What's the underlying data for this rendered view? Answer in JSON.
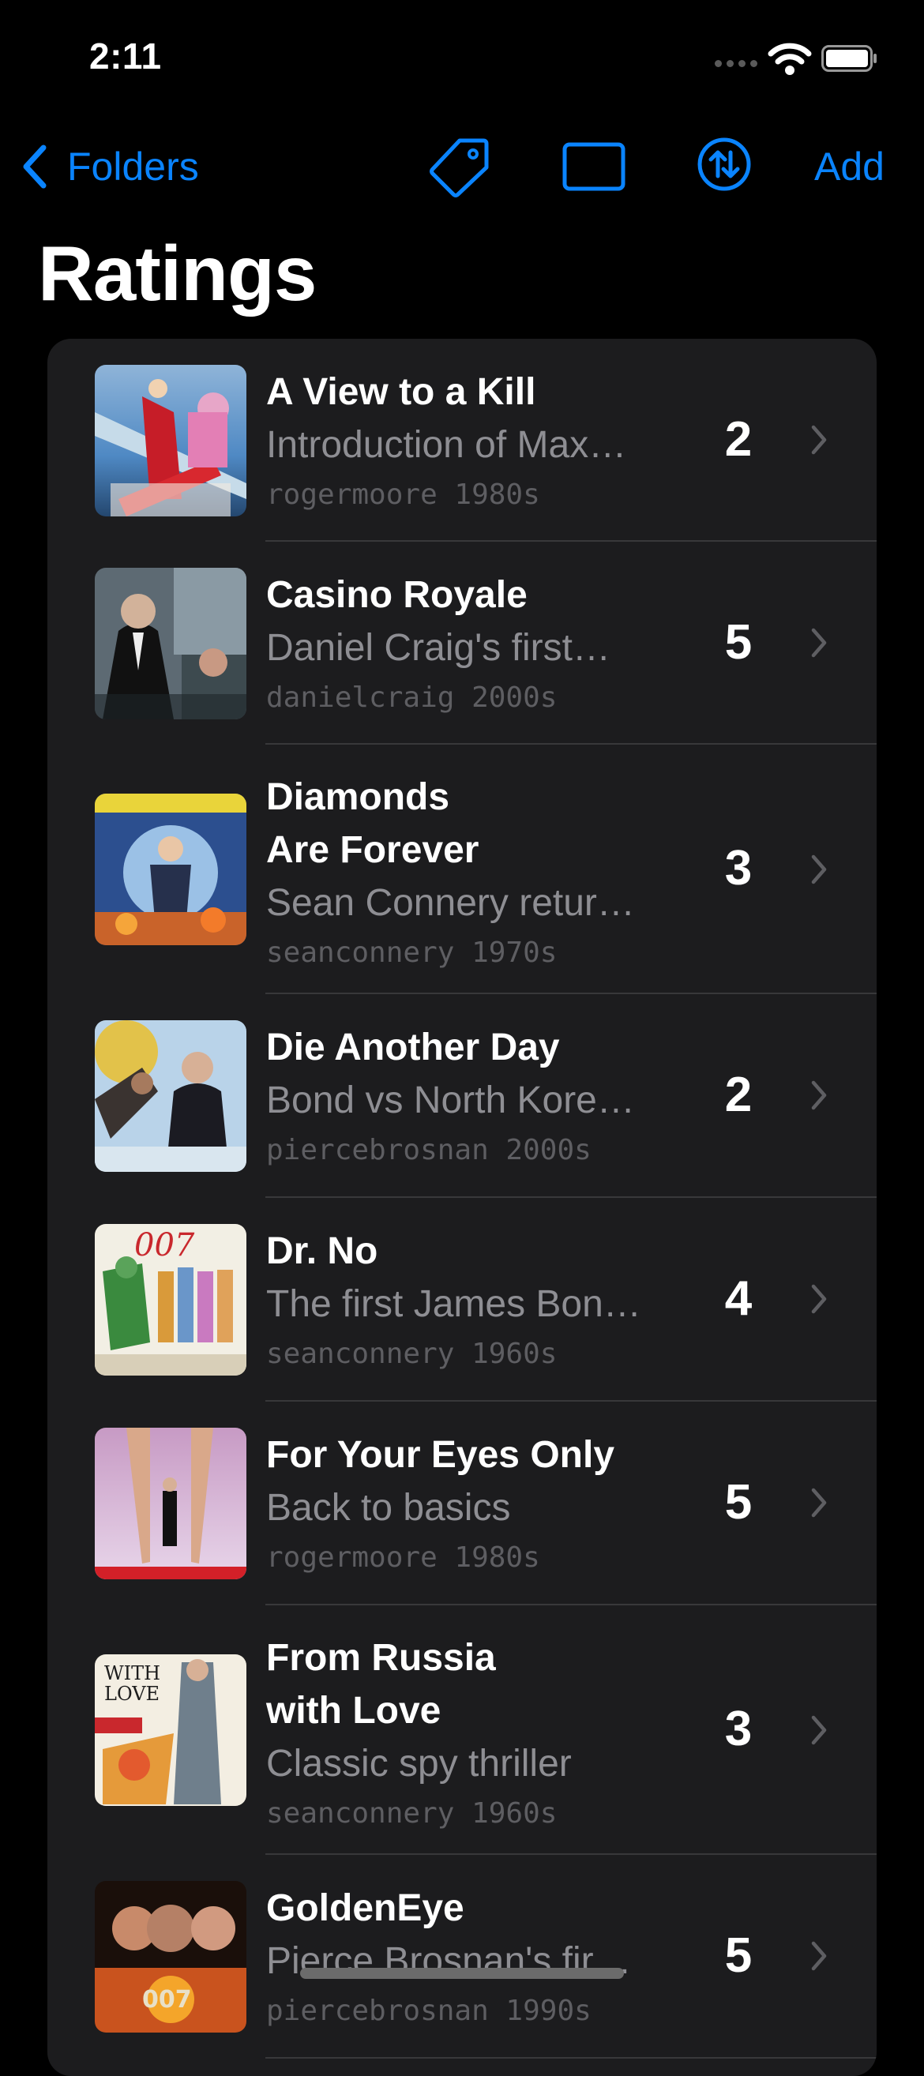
{
  "status": {
    "time": "2:11"
  },
  "nav": {
    "back_label": "Folders",
    "add_label": "Add"
  },
  "page": {
    "title": "Ratings"
  },
  "colors": {
    "accent": "#0a84ff",
    "background": "#000000",
    "card": "#1c1c1e",
    "secondary_text": "#8e8e93",
    "tertiary_text": "#5e5e62"
  },
  "items": [
    {
      "title": "A View to a Kill",
      "subtitle": "Introduction of Max…",
      "meta": "rogermoore 1980s",
      "rating": "2",
      "thumbnail": "a-view-to-a-kill-poster"
    },
    {
      "title": "Casino Royale",
      "subtitle": "Daniel Craig's first…",
      "meta": "danielcraig 2000s",
      "rating": "5",
      "thumbnail": "casino-royale-poster"
    },
    {
      "title": "Diamonds\nAre Forever",
      "subtitle": "Sean Connery retur…",
      "meta": "seanconnery 1970s",
      "rating": "3",
      "thumbnail": "diamonds-are-forever-poster"
    },
    {
      "title": "Die Another Day",
      "subtitle": "Bond vs North Kore…",
      "meta": "piercebrosnan 2000s",
      "rating": "2",
      "thumbnail": "die-another-day-poster"
    },
    {
      "title": "Dr. No",
      "subtitle": "The first James Bon…",
      "meta": "seanconnery 1960s",
      "rating": "4",
      "thumbnail": "dr-no-poster"
    },
    {
      "title": "For Your Eyes Only",
      "subtitle": "Back to basics",
      "meta": "rogermoore 1980s",
      "rating": "5",
      "thumbnail": "for-your-eyes-only-poster"
    },
    {
      "title": "From Russia\nwith Love",
      "subtitle": "Classic spy thriller",
      "meta": "seanconnery 1960s",
      "rating": "3",
      "thumbnail": "from-russia-with-love-poster"
    },
    {
      "title": "GoldenEye",
      "subtitle": "Pierce Brosnan's fir…",
      "meta": "piercebrosnan 1990s",
      "rating": "5",
      "thumbnail": "goldeneye-poster"
    }
  ]
}
